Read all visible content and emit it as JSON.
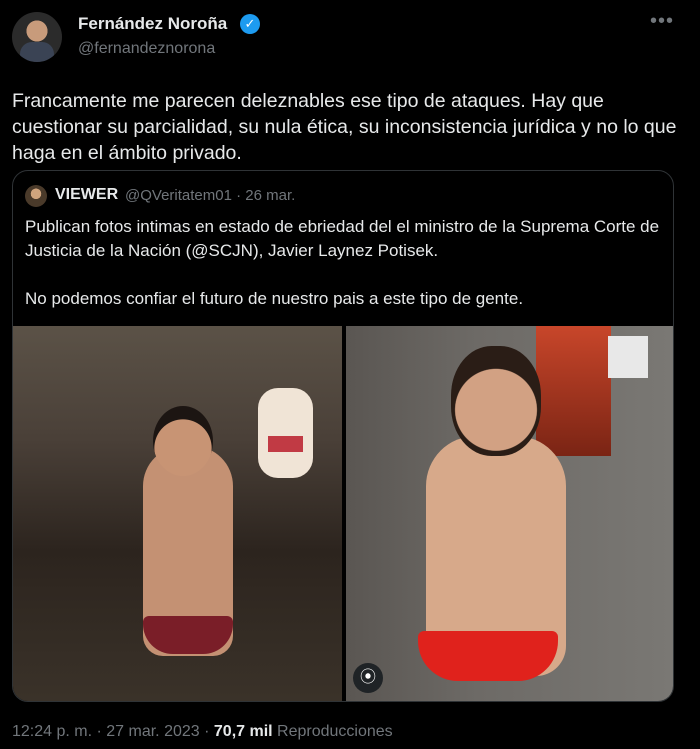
{
  "author": {
    "display_name": "Fernández Noroña",
    "handle": "@fernandeznorona",
    "verified_icon": "✓"
  },
  "more_menu": "•••",
  "tweet": {
    "text": "Francamente me parecen deleznables ese tipo de ataques. Hay que cuestionar su parcialidad, su nula ética, su inconsistencia jurídica y no lo que haga en el ámbito privado."
  },
  "quote": {
    "display_name": "VIEWER",
    "handle_time": "@QVeritatem01 · 26 mar.",
    "paragraph1": "Publican fotos intimas en estado de ebriedad del el ministro de la Suprema Corte de Justicia de la Nación (@SCJN), Javier Laynez Potisek.",
    "paragraph2": "No podemos confiar el futuro de nuestro pais a este tipo de gente."
  },
  "media_icon": "⦿",
  "meta": {
    "time_date": "12:24 p. m. · 27 mar. 2023 · ",
    "views_count": "70,7 mil",
    "views_label": " Reproducciones"
  },
  "colors": {
    "background": "#000000",
    "text": "#e7e9ea",
    "secondary": "#71767b",
    "verified": "#1d9bf0",
    "border": "#2f3336"
  }
}
